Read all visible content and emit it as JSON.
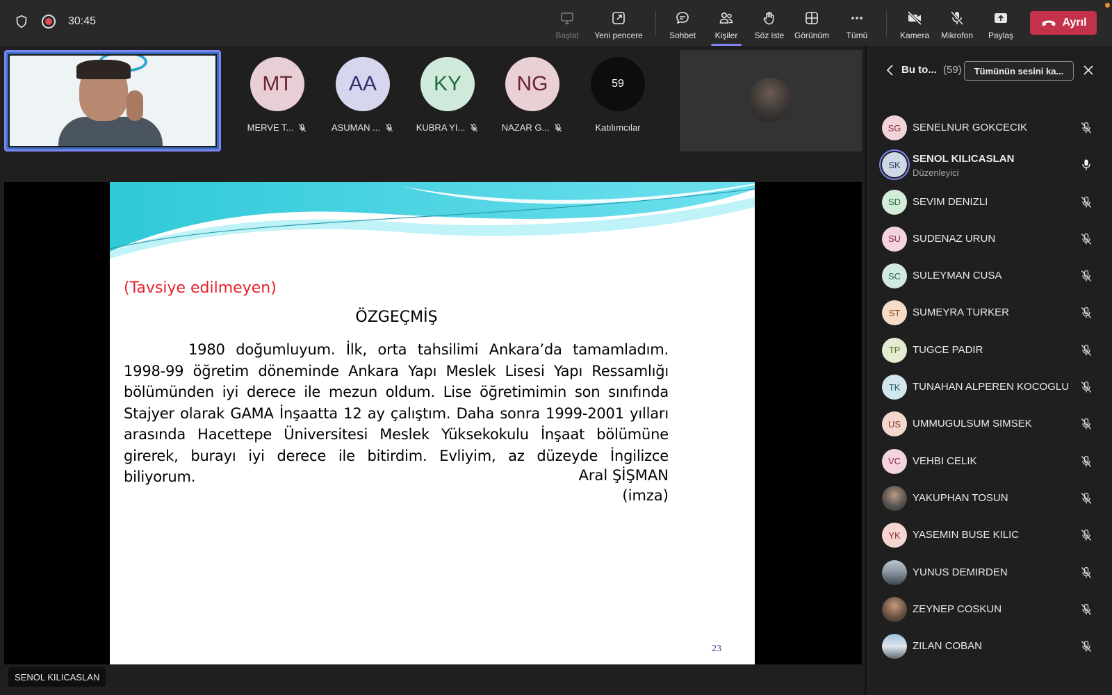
{
  "toolbar": {
    "timer": "30:45",
    "buttons": [
      {
        "label": "Başlat"
      },
      {
        "label": "Yeni pencere"
      },
      {
        "label": "Sohbet"
      },
      {
        "label": "Kişiler"
      },
      {
        "label": "Söz iste"
      },
      {
        "label": "Görünüm"
      },
      {
        "label": "Tümü"
      },
      {
        "label": "Kamera"
      },
      {
        "label": "Mikrofon"
      },
      {
        "label": "Paylaş"
      }
    ],
    "leave_label": "Ayrıl"
  },
  "gallery": {
    "tiles": [
      {
        "initials": "MT",
        "name": "MERVE T...",
        "bg": "#e8cfd5",
        "fg": "#6b2430"
      },
      {
        "initials": "AA",
        "name": "ASUMAN ...",
        "bg": "#d6d6ee",
        "fg": "#2f2f72"
      },
      {
        "initials": "KY",
        "name": "KUBRA YI...",
        "bg": "#cfeadb",
        "fg": "#1f6b3e"
      },
      {
        "initials": "NG",
        "name": "NAZAR G...",
        "bg": "#ead0d4",
        "fg": "#6b2430"
      }
    ],
    "participant_count": "59",
    "participants_label": "Katılımcılar"
  },
  "slide": {
    "red_heading": "(Tavsiye edilmeyen)",
    "title": "ÖZGEÇMİŞ",
    "body": "1980 doğumluyum. İlk, orta tahsilimi Ankara’da tamamladım. 1998-99 öğretim döneminde Ankara Yapı Meslek Lisesi Yapı Ressamlığı bölümünden iyi derece ile mezun oldum. Lise öğretimimin son sınıfında Stajyer olarak GAMA İnşaatta 12 ay çalıştım. Daha sonra 1999-2001 yılları arasında Hacettepe Üniversitesi Meslek Yüksekokulu İnşaat bölümüne girerek, burayı iyi derece ile bitirdim. Evliyim, az düzeyde İngilizce biliyorum.",
    "sign_name": "Aral ŞİŞMAN",
    "sign_note": "(imza)",
    "page_number": "23"
  },
  "presenter_name": "SENOL KILICASLAN",
  "panel": {
    "title": "Bu to...",
    "count": "(59)",
    "mute_all_label": "Tümünün sesini ka...",
    "participants": [
      {
        "initials": "SG",
        "name": "SENELNUR GOKCECIK",
        "bg": "#f2d3d8",
        "fg": "#8a2b3c"
      },
      {
        "initials": "SK",
        "name": "SENOL KILICASLAN",
        "role": "Düzenleyici",
        "bg": "#cfd8e6",
        "fg": "#2d3f5c"
      },
      {
        "initials": "SD",
        "name": "SEVIM DENIZLI",
        "bg": "#d3ebd9",
        "fg": "#2d6b3e"
      },
      {
        "initials": "SU",
        "name": "SUDENAZ URUN",
        "bg": "#f3d3de",
        "fg": "#8a2b52"
      },
      {
        "initials": "SC",
        "name": "SULEYMAN CUSA",
        "bg": "#d0eadf",
        "fg": "#2b6b50"
      },
      {
        "initials": "ST",
        "name": "SUMEYRA TURKER",
        "bg": "#f6dcc6",
        "fg": "#8a4a1f"
      },
      {
        "initials": "TP",
        "name": "TUGCE PADIR",
        "bg": "#e3ecd0",
        "fg": "#5a6b22"
      },
      {
        "initials": "TK",
        "name": "TUNAHAN ALPEREN KOCOGLU",
        "bg": "#d2e6ee",
        "fg": "#27586b"
      },
      {
        "initials": "US",
        "name": "UMMUGULSUM SIMSEK",
        "bg": "#f4d8cf",
        "fg": "#8a3a24"
      },
      {
        "initials": "VC",
        "name": "VEHBI CELIK",
        "bg": "#f3d3dc",
        "fg": "#8a2b48"
      },
      {
        "initials": "",
        "name": "YAKUPHAN TOSUN",
        "photo": "photo-av"
      },
      {
        "initials": "YK",
        "name": "YASEMIN BUSE KILIC",
        "bg": "#f5d6d2",
        "fg": "#8a3229"
      },
      {
        "initials": "",
        "name": "YUNUS DEMIRDEN",
        "photo": "photo-av2"
      },
      {
        "initials": "",
        "name": "ZEYNEP COSKUN",
        "photo": "photo-av3"
      },
      {
        "initials": "",
        "name": "ZILAN COBAN",
        "photo": "photo-av4"
      }
    ]
  },
  "colors": {
    "accent": "#7f85f5",
    "leave": "#c4314b",
    "slide_red": "#e8202a"
  }
}
